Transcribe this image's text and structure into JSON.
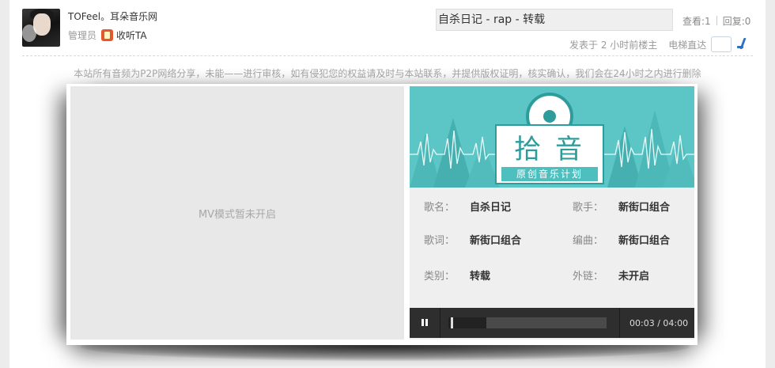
{
  "author": {
    "name": "TOFeel。耳朵音乐网",
    "role": "管理员",
    "follow_label": "收听TA"
  },
  "post": {
    "title": "自杀日记 - rap - 转载",
    "views_label": "查看:1",
    "replies_label": "回复:0",
    "posted": "发表于 2 小时前楼主",
    "elevator_label": "电梯直达"
  },
  "notice": "本站所有音频为P2P网络分享，未能——进行审核，如有侵犯您的权益请及时与本站联系，并提供版权证明，核实确认，我们会在24小时之内进行删除",
  "mv": {
    "placeholder": "MV模式暂未开启"
  },
  "banner": {
    "title": "拾音",
    "subtitle": "原创音乐计划"
  },
  "song": {
    "name_key": "歌名：",
    "name": "自杀日记",
    "singer_key": "歌手：",
    "singer": "新街口组合",
    "lyrics_key": "歌词：",
    "lyrics": "新街口组合",
    "composer_key": "编曲：",
    "composer": "新街口组合",
    "category_key": "类别：",
    "category": "转载",
    "link_key": "外链：",
    "link": "未开启"
  },
  "player": {
    "state": "paused-icon",
    "time": "00:03 / 04:00",
    "progress": 0.0125,
    "buffered": 0.24
  },
  "colors": {
    "banner_teal": "#5cc6c6",
    "logo_teal": "#2f9c9c",
    "badge_orange": "#e5562a",
    "player_bg": "#2e2e2e"
  }
}
